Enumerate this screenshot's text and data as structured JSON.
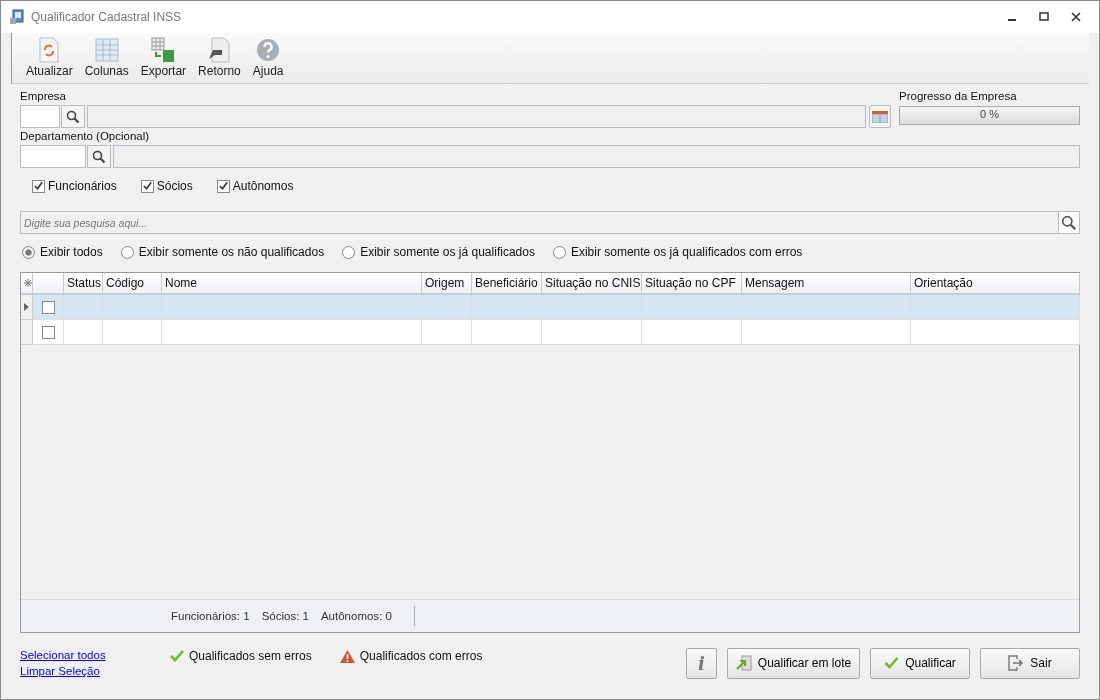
{
  "window": {
    "title": "Qualificador Cadastral INSS"
  },
  "toolbar": [
    {
      "kind": "refresh",
      "label": "Atualizar"
    },
    {
      "kind": "columns",
      "label": "Colunas"
    },
    {
      "kind": "export",
      "label": "Exportar"
    },
    {
      "kind": "return",
      "label": "Retorno"
    },
    {
      "kind": "help",
      "label": "Ajuda"
    }
  ],
  "empresa": {
    "label": "Empresa"
  },
  "progress": {
    "label": "Progresso da Empresa",
    "level": 0,
    "reading": "0 %"
  },
  "departamento": {
    "label": "Departamento (Opcional)"
  },
  "filters": [
    {
      "label": "Funcionários",
      "checked": true
    },
    {
      "label": "Sócios",
      "checked": true
    },
    {
      "label": "Autônomos",
      "checked": true
    }
  ],
  "search": {
    "placeholder": "Digite sua pesquisa aqui..."
  },
  "view_options": [
    {
      "label": "Exibir todos",
      "selected": true
    },
    {
      "label": "Exibir somente os não qualificados",
      "selected": false
    },
    {
      "label": "Exibir somente os já qualificados",
      "selected": false
    },
    {
      "label": "Exibir somente os já qualificados com erros",
      "selected": false
    }
  ],
  "table": {
    "columns": [
      "Status",
      "Código",
      "Nome",
      "Origem",
      "Beneficiário",
      "Situação no CNIS",
      "Situação no CPF",
      "Mensagem",
      "Orientação"
    ],
    "rows": [
      {
        "selected": true,
        "checked": false
      },
      {
        "selected": false,
        "checked": false
      }
    ]
  },
  "status_bar": [
    "Funcionários: 1",
    "Sócios: 1",
    "Autônomos: 0"
  ],
  "links": [
    "Selecionar todos",
    "Limpar Seleção"
  ],
  "legend": [
    {
      "kind": "ok",
      "label": "Qualificados sem erros"
    },
    {
      "kind": "error",
      "label": "Qualificados com erros"
    }
  ],
  "buttons": [
    {
      "kind": "info",
      "label": "i"
    },
    {
      "kind": "batch",
      "label": "Qualificar em lote"
    },
    {
      "kind": "qualify",
      "label": "Qualificar"
    },
    {
      "kind": "exit",
      "label": "Sair"
    }
  ]
}
